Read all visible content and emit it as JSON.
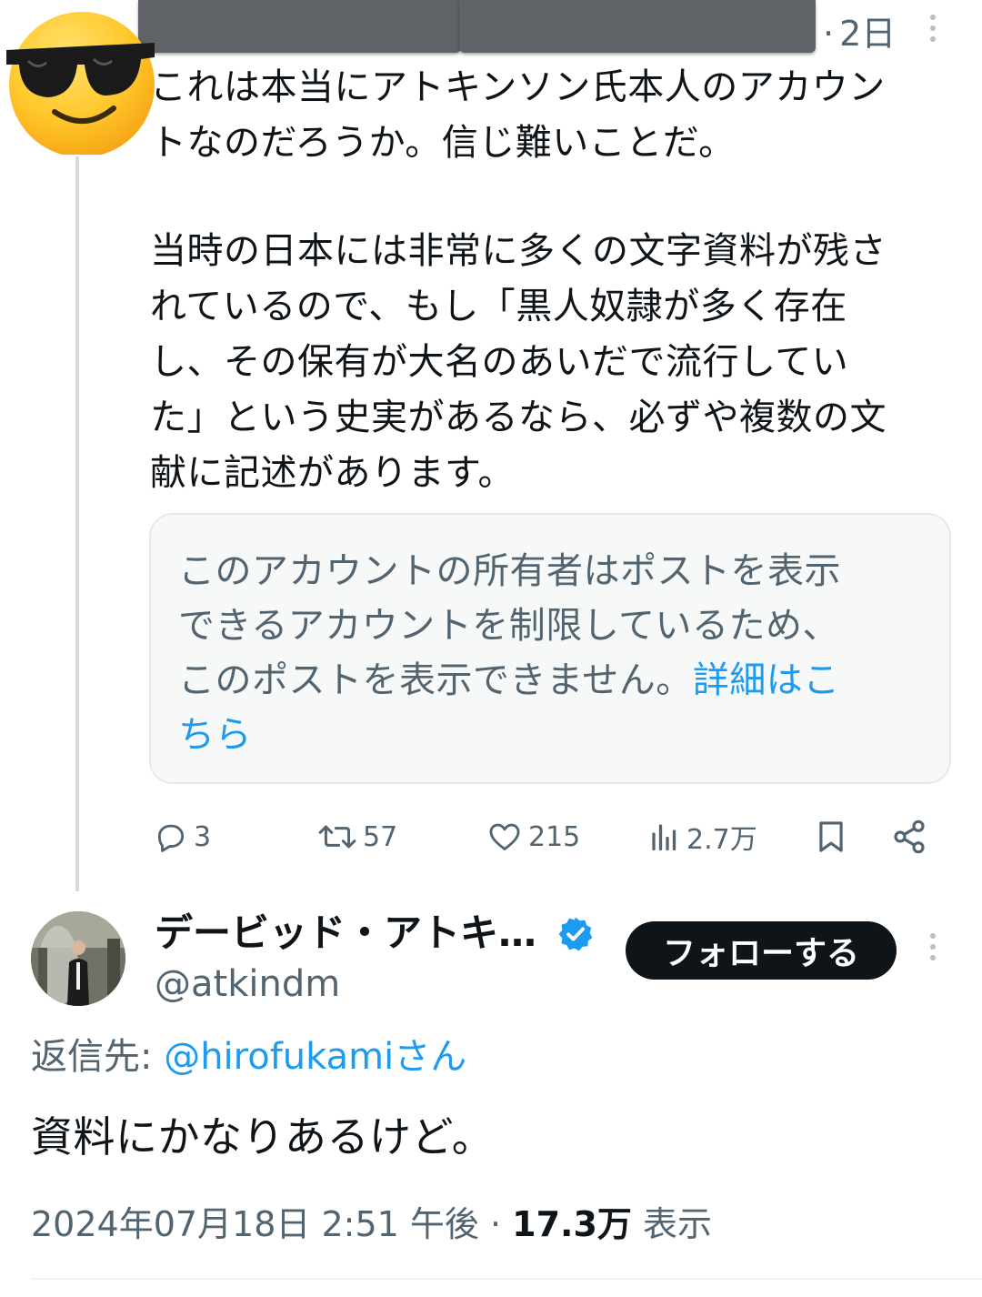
{
  "thread_tweet": {
    "relative_time": "2日",
    "paragraph_1": "これは本当にアトキンソン氏本人のアカウン\nトなのだろうか。信じ難いことだ。",
    "paragraph_2": "当時の日本には非常に多くの文字資料が残さ\nれているので、もし「黒人奴隷が多く存在\nし、その保有が大名のあいだで流行してい\nた」という史実があるなら、必ずや複数の文\n献に記述があります。",
    "quote_notice": "このアカウントの所有者はポストを表示\nできるアカウントを制限しているため、\nこのポストを表示できません。",
    "quote_link": "詳細はこ\nちら",
    "actions": {
      "replies": "3",
      "reposts": "57",
      "likes": "215",
      "views": "2.7万"
    }
  },
  "main_tweet": {
    "display_name": "デービッド・アトキ…",
    "handle": "@atkindm",
    "follow_label": "フォローする",
    "reply_prefix": "返信先: ",
    "reply_mention": "@hirofukami",
    "reply_suffix": "さん",
    "text": "資料にかなりあるけど。",
    "date_time": "2024年07月18日 2:51 午後 · ",
    "views_count": "17.3万",
    "views_label": " 表示"
  },
  "colors": {
    "text_primary": "#0f1419",
    "text_secondary": "#536471",
    "link": "#1d9bf0",
    "verified": "#1d9bf0",
    "follow_bg": "#0f1419"
  }
}
